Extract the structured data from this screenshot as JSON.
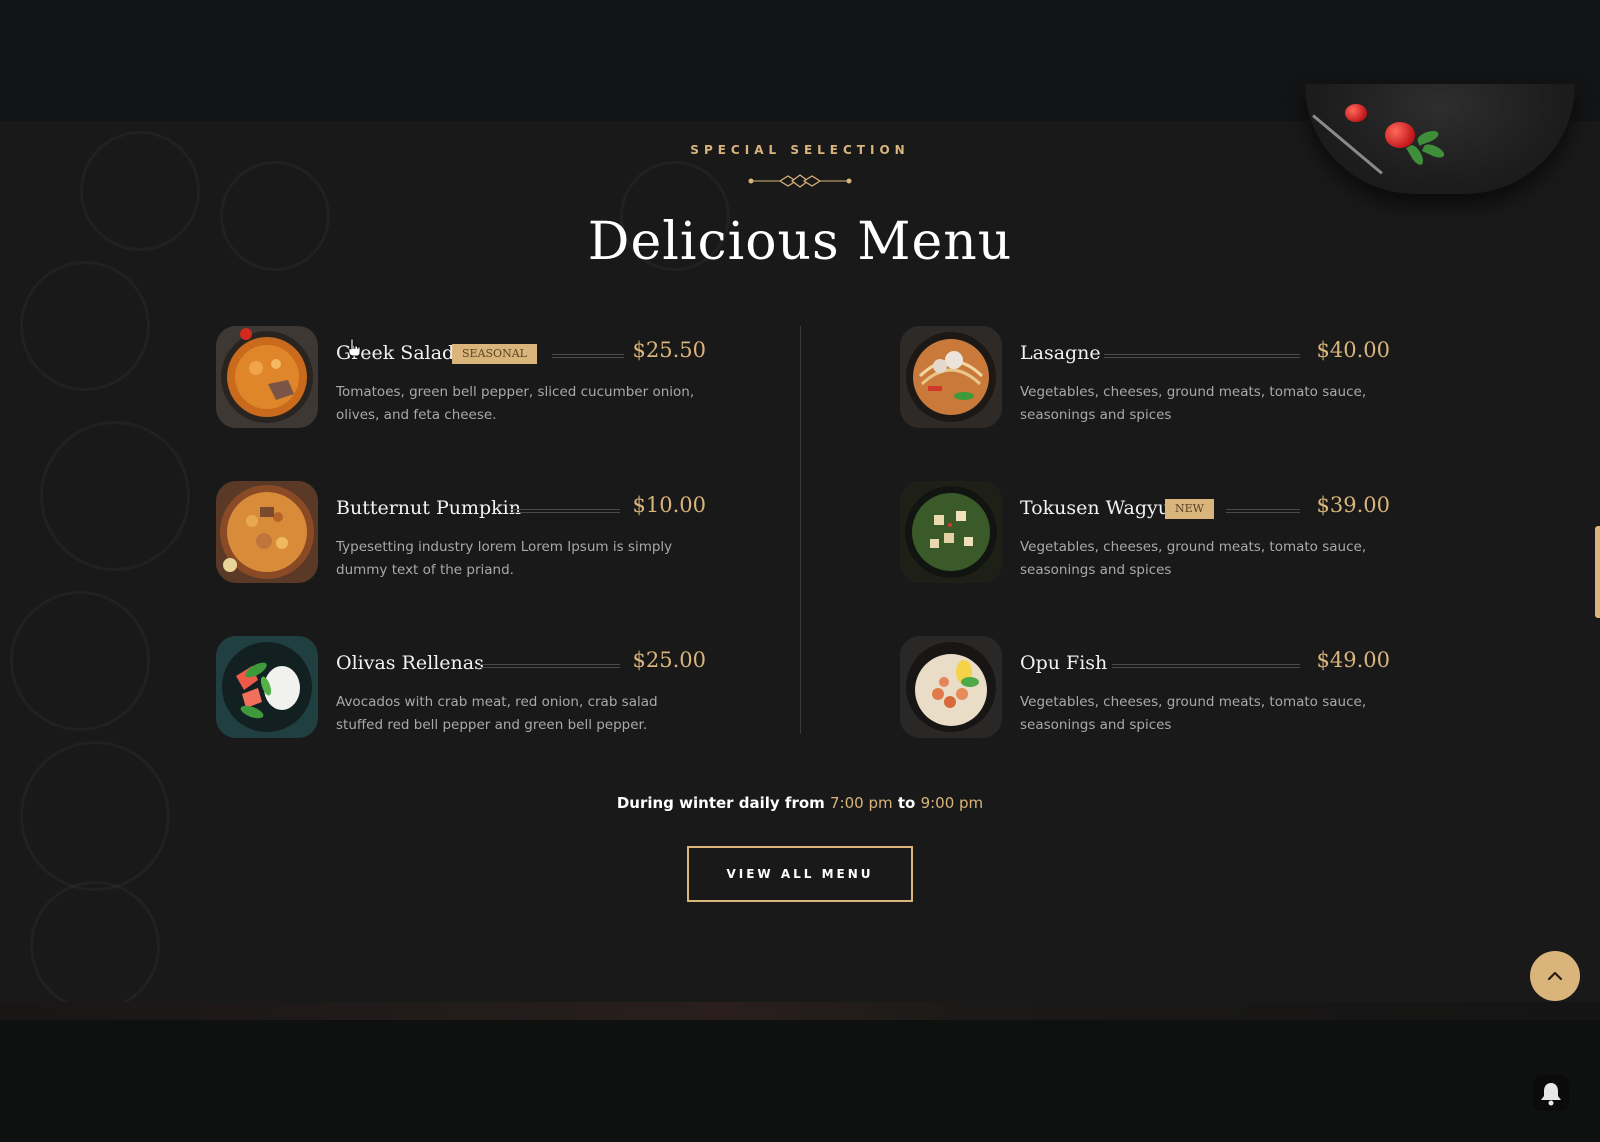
{
  "section": {
    "eyebrow": "SPECIAL SELECTION",
    "title": "Delicious Menu"
  },
  "menu": {
    "left": [
      {
        "name": "Greek Salad",
        "badge": "SEASONAL",
        "price": "$25.50",
        "description": "Tomatoes, green bell pepper, sliced cucumber onion, olives, and feta cheese."
      },
      {
        "name": "Butternut Pumpkin",
        "badge": "",
        "price": "$10.00",
        "description": "Typesetting industry lorem Lorem Ipsum is simply dummy text of the priand."
      },
      {
        "name": "Olivas Rellenas",
        "badge": "",
        "price": "$25.00",
        "description": "Avocados with crab meat, red onion, crab salad stuffed red bell pepper and green bell pepper."
      }
    ],
    "right": [
      {
        "name": "Lasagne",
        "badge": "",
        "price": "$40.00",
        "description": "Vegetables, cheeses, ground meats, tomato sauce, seasonings and spices"
      },
      {
        "name": "Tokusen Wagyu",
        "badge": "NEW",
        "price": "$39.00",
        "description": "Vegetables, cheeses, ground meats, tomato sauce, seasonings and spices"
      },
      {
        "name": "Opu Fish",
        "badge": "",
        "price": "$49.00",
        "description": "Vegetables, cheeses, ground meats, tomato sauce, seasonings and spices"
      }
    ]
  },
  "hours": {
    "prefix": "During winter daily from",
    "start": "7:00 pm",
    "connector": "to",
    "end": "9:00 pm"
  },
  "cta": {
    "label": "VIEW ALL MENU"
  },
  "icons": {
    "scroll_top": "chevron-up-icon",
    "notifications": "bell-icon"
  },
  "colors": {
    "accent": "#d9b47b",
    "background": "#19191a",
    "text": "#ffffff",
    "muted_text": "#a9a9a9"
  }
}
